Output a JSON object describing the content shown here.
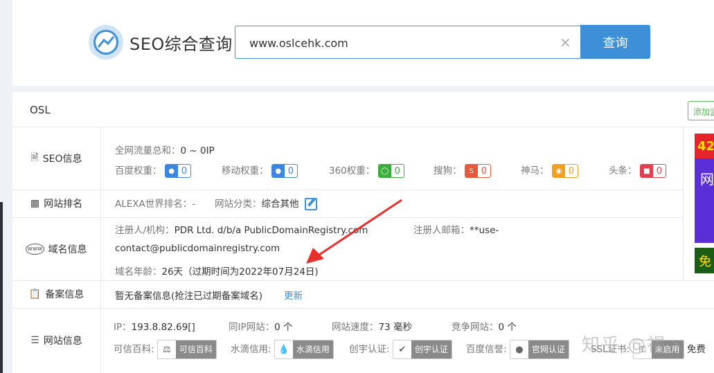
{
  "header": {
    "title": "SEO综合查询",
    "search_value": "www.oslcehk.com",
    "clear_label": "×",
    "search_button": "查询"
  },
  "site": {
    "name": "OSL",
    "add_button": "添加监"
  },
  "rows": {
    "seo": {
      "label": "SEO信息",
      "traffic_label": "全网流量总和：",
      "traffic_value": "0 ~ 0IP",
      "weights": [
        {
          "label": "百度权重：",
          "value": "0",
          "icon": "paw-icon"
        },
        {
          "label": "移动权重：",
          "value": "0",
          "icon": "paw-icon"
        },
        {
          "label": "360权重：",
          "value": "0",
          "icon": "360-icon"
        },
        {
          "label": "搜狗：",
          "value": "0",
          "icon": "sogou-icon"
        },
        {
          "label": "神马：",
          "value": "0",
          "icon": "shenma-icon"
        },
        {
          "label": "头条：",
          "value": "0",
          "icon": "toutiao-icon"
        }
      ]
    },
    "rank": {
      "label": "网站排名",
      "alexa_label": "ALEXA世界排名：",
      "alexa_value": "-",
      "category_label": "网站分类：",
      "category_value": "综合其他"
    },
    "domain": {
      "label": "域名信息",
      "registrant_label": "注册人/机构：",
      "registrant_value": "PDR Ltd. d/b/a PublicDomainRegistry.com",
      "email_label": "注册人邮箱：",
      "email_value_1": "**use-",
      "email_value_2": "contact@publicdomainregistry.com",
      "age_label": "域名年龄：",
      "age_value": "26天（过期时间为2022年07月24日)"
    },
    "icp": {
      "label": "备案信息",
      "text": "暂无备案信息(抢注已过期备案域名)",
      "update_link": "更新"
    },
    "info": {
      "label": "网站信息",
      "ip_label": "IP：",
      "ip_value": "193.8.82.69[]",
      "same_ip_label": "同IP网站：",
      "same_ip_value": "0 个",
      "speed_label": "网站速度：",
      "speed_value": "73 毫秒",
      "competitor_label": "竞争网站：",
      "competitor_value": "0 个",
      "credits": [
        {
          "label": "可信百科:",
          "badge": "可信百科"
        },
        {
          "label": "水滴信用:",
          "badge": "水滴信用"
        },
        {
          "label": "创宇认证:",
          "badge": "创宇认证"
        },
        {
          "label": "百度信誉:",
          "badge": "官网认证"
        }
      ],
      "ssl_label": "SSL证书:",
      "ssl_badge": "未启用",
      "ssl_extra": "免费"
    }
  },
  "ad": {
    "a1": "42",
    "a2": "网",
    "a3": "免"
  },
  "watermark": "知乎 @褐丶",
  "colors": {
    "accent": "#3d8fd8",
    "arrow": "#e8302a"
  }
}
